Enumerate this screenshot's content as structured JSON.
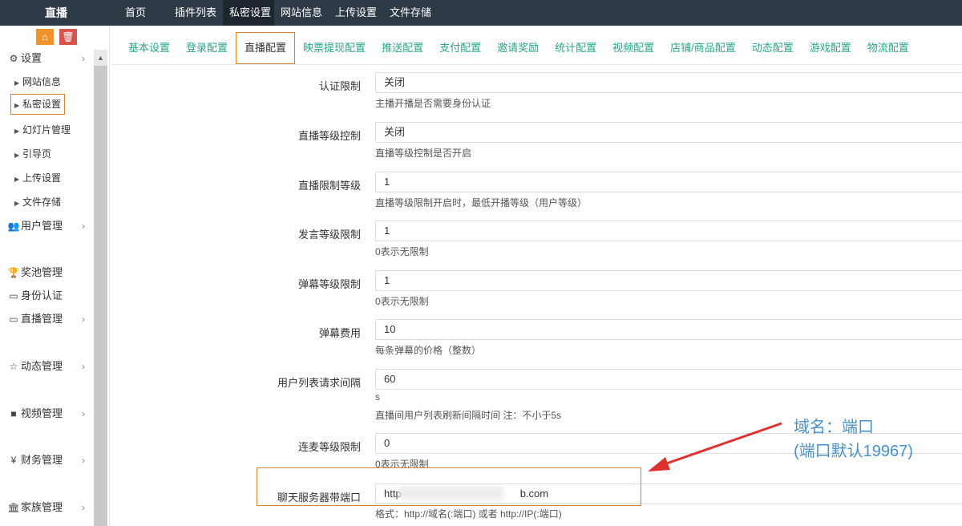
{
  "brand": "直播",
  "topnav": [
    "首页",
    "插件列表",
    "私密设置",
    "网站信息",
    "上传设置",
    "文件存储"
  ],
  "topnav_active": 2,
  "sidebar": {
    "settings": "设置",
    "sub": [
      "网站信息",
      "私密设置",
      "幻灯片管理",
      "引导页",
      "上传设置",
      "文件存储"
    ],
    "user": "用户管理",
    "prize": "奖池管理",
    "identity": "身份认证",
    "live": "直播管理",
    "dynamic": "动态管理",
    "video": "视频管理",
    "finance": "财务管理",
    "family": "家族管理"
  },
  "tabs": [
    "基本设置",
    "登录配置",
    "直播配置",
    "映票提现配置",
    "推送配置",
    "支付配置",
    "邀请奖励",
    "统计配置",
    "视频配置",
    "店铺/商品配置",
    "动态配置",
    "游戏配置",
    "物流配置"
  ],
  "tab_active": 2,
  "form": [
    {
      "label": "认证限制",
      "value": "关闭",
      "help": "主播开播是否需要身份认证"
    },
    {
      "label": "直播等级控制",
      "value": "关闭",
      "help": "直播等级控制是否开启"
    },
    {
      "label": "直播限制等级",
      "value": "1",
      "help": "直播等级限制开启时，最低开播等级（用户等级）"
    },
    {
      "label": "发言等级限制",
      "value": "1",
      "help": "0表示无限制"
    },
    {
      "label": "弹幕等级限制",
      "value": "1",
      "help": "0表示无限制"
    },
    {
      "label": "弹幕费用",
      "value": "10",
      "help": "每条弹幕的价格（整数）"
    },
    {
      "label": "用户列表请求间隔",
      "value": "60",
      "help": "s",
      "help2": "直播间用户列表刷新间隔时间 注：不小于5s"
    },
    {
      "label": "连麦等级限制",
      "value": "0",
      "help": "0表示无限制"
    },
    {
      "label": "聊天服务器带端口",
      "value": "http",
      "value_tail": "b.com",
      "help": "格式：http://域名(:端口) 或者 http://IP(:端口)"
    }
  ],
  "annotation": {
    "line1": "域名：端口",
    "line2": "(端口默认19967)"
  },
  "colors": {
    "topbar": "#2e3a46",
    "tab_text": "#2aa58b",
    "highlight": "#d9822b",
    "annotation": "#4a90c8",
    "arrow": "#e03131"
  }
}
